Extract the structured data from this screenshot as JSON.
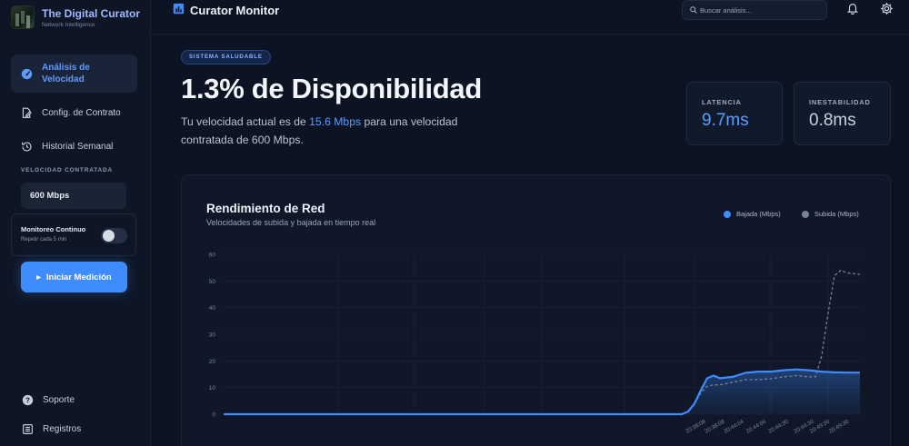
{
  "brand": {
    "title": "The Digital Curator",
    "subtitle": "Network Intelligence"
  },
  "sidebar": {
    "items": [
      {
        "label": "Análisis de Velocidad",
        "icon": "speedometer-icon",
        "active": true
      },
      {
        "label": "Config. de Contrato",
        "icon": "edit-document-icon",
        "active": false
      },
      {
        "label": "Historial Semanal",
        "icon": "history-icon",
        "active": false
      }
    ],
    "section_label": "VELOCIDAD CONTRATADA",
    "contract_speed": "600 Mbps",
    "monitor": {
      "title": "Monitoreo Continuo",
      "subtitle": "Repetir cada 5 min",
      "enabled": false
    },
    "start_button": "Iniciar Medición",
    "footer": [
      {
        "label": "Soporte",
        "icon": "help-icon"
      },
      {
        "label": "Registros",
        "icon": "list-icon"
      }
    ]
  },
  "topbar": {
    "title": "Curator Monitor",
    "search_placeholder": "Buscar análisis...",
    "icons": [
      "bell-icon",
      "gear-icon"
    ]
  },
  "hero": {
    "badge": "SISTEMA SALUDABLE",
    "title": "1.3% de Disponibilidad",
    "text_prefix": "Tu velocidad actual es de ",
    "current_speed": "15.6 Mbps",
    "text_suffix": " para una velocidad contratada de 600 Mbps."
  },
  "stats": {
    "latency": {
      "label": "LATENCIA",
      "value": "9.7ms"
    },
    "instability": {
      "label": "INESTABILIDAD",
      "value": "0.8ms"
    }
  },
  "colors": {
    "accent": "#3f8cff",
    "background": "#0c1322",
    "upload": "#7a8394"
  },
  "chart_data": {
    "type": "line",
    "title": "Rendimiento de Red",
    "subtitle": "Velocidades de subida y bajada en tiempo real",
    "ylim": [
      0,
      60
    ],
    "yticks": [
      0,
      10,
      20,
      30,
      40,
      50,
      60
    ],
    "xticks": [
      "20:38:08",
      "20:38:08",
      "20:44:04",
      "20:44:04",
      "20:44:30",
      "20:44:30",
      "20:49:30",
      "20:49:30"
    ],
    "grid": true,
    "legend_position": "top-right",
    "series": [
      {
        "name": "Bajada (Mbps)",
        "color": "#3f8cff",
        "style": "solid-filled",
        "x": [
          0,
          10,
          20,
          30,
          40,
          50,
          60,
          70,
          72,
          73,
          74,
          75,
          76,
          77,
          78,
          80,
          82,
          84,
          86,
          88,
          90,
          92,
          94,
          96,
          98,
          100
        ],
        "y": [
          0,
          0,
          0,
          0,
          0,
          0,
          0,
          0,
          0,
          1,
          4,
          9,
          13.5,
          14.5,
          13.5,
          14,
          15.5,
          16,
          16,
          16.5,
          16.8,
          16.5,
          16,
          15.7,
          15.6,
          15.6
        ]
      },
      {
        "name": "Subida (Mbps)",
        "color": "#7a8394",
        "style": "dashed",
        "x": [
          0,
          10,
          20,
          30,
          40,
          50,
          60,
          70,
          72,
          73,
          74,
          75,
          76,
          77,
          78,
          80,
          82,
          84,
          86,
          88,
          90,
          92,
          93,
          94,
          95,
          96,
          97,
          98,
          100
        ],
        "y": [
          0,
          0,
          0,
          0,
          0,
          0,
          0,
          0,
          0,
          1,
          4,
          8,
          10.5,
          11,
          11,
          12,
          13,
          13,
          13.3,
          14,
          14.5,
          14,
          14,
          22,
          38,
          52,
          54,
          53,
          52.5
        ]
      }
    ]
  }
}
